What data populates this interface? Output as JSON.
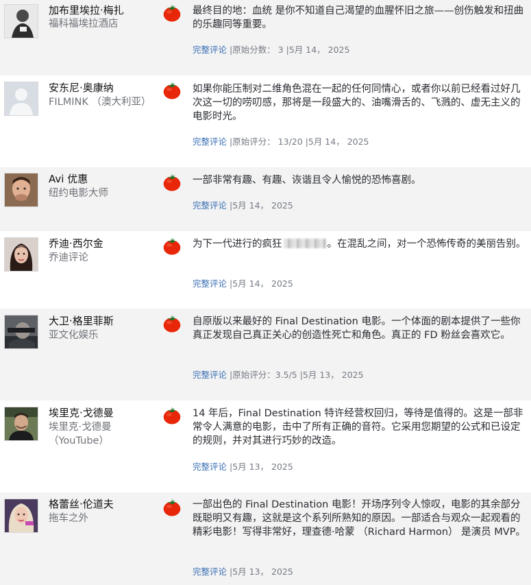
{
  "colors": {
    "tomato": "#e8270a",
    "link": "#3a6fb5",
    "muted": "#757a84",
    "row_shade": "#f3f3f3"
  },
  "icons": {
    "score": "fresh-tomato-icon"
  },
  "meta_separator": " |",
  "full_review_label": "完整评论",
  "reviews": [
    {
      "critic": "加布里埃拉·梅扎",
      "publication": "福科福埃拉酒店",
      "quote": "最终目的地：血统 是你不知道自己渴望的血腥怀旧之旅——创伤触发和扭曲的乐趣同等重要。",
      "meta": "原始分数： 3 |5月 14， 2025"
    },
    {
      "critic": "安东尼·奥康纳",
      "publication": "FILMINK （澳大利亚）",
      "quote": "如果你能压制对二维角色混在一起的任何同情心，或者你以前已经看过好几次这一切的唠叨感，那将是一段盛大的、油嘴滑舌的、飞溅的、虚无主义的电影时光。",
      "meta": "原始评分： 13/20 |5月 14， 2025"
    },
    {
      "critic": "Avi 优惠",
      "publication": "纽约电影大师",
      "quote": "一部非常有趣、有趣、诙谐且令人愉悦的恐怖喜剧。",
      "meta": "5月 14， 2025"
    },
    {
      "critic": "乔迪·西尔金",
      "publication": "乔迪评论",
      "quote_before": "为下一代进行的疯狂",
      "quote_after": "。在混乱之间，对一个恐怖传奇的美丽告别。",
      "meta": "5月 14， 2025"
    },
    {
      "critic": "大卫·格里菲斯",
      "publication": "亚文化娱乐",
      "quote": "自原版以来最好的 Final Destination 电影。一个体面的剧本提供了一些你真正发现自己真正关心的创造性死亡和角色。真正的 FD 粉丝会喜欢它。",
      "meta": "原始评分：3.5/5 |5月 13， 2025"
    },
    {
      "critic": "埃里克·戈德曼",
      "publication": "埃里克·戈德曼 （YouTube）",
      "quote": "14 年后，Final Destination 特许经营权回归，等待是值得的。这是一部非常令人满意的电影，击中了所有正确的音符。它采用您期望的公式和已设定的规则，并对其进行巧妙的改造。",
      "meta": "5月 13， 2025"
    },
    {
      "critic": "格蕾丝·伦道夫",
      "publication": "拖车之外",
      "quote": "一部出色的 Final Destination 电影！开场序列令人惊叹，电影的其余部分既聪明又有趣，这就是这个系列所熟知的原因。一部适合与观众一起观看的精彩电影！写得非常好，理查德·哈蒙 （Richard Harmon） 是演员 MVP。",
      "meta": "5月 13， 2025"
    }
  ]
}
